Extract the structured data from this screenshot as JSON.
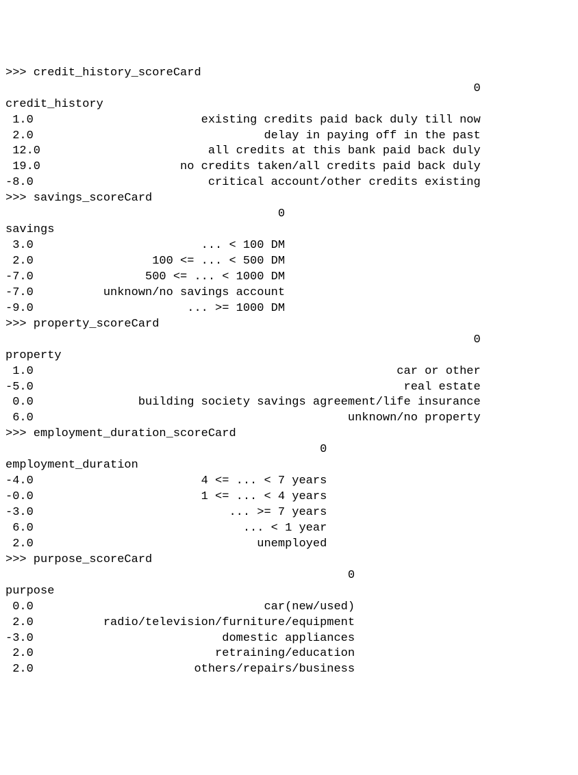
{
  "prompt": ">>>",
  "commands": {
    "credit_history": "credit_history_scoreCard",
    "savings": "savings_scoreCard",
    "property": "property_scoreCard",
    "employment": "employment_duration_scoreCard",
    "purpose": "purpose_scoreCard"
  },
  "col_header": "0",
  "credit_history": {
    "header": "credit_history",
    "rows": [
      {
        "score": " 1.0",
        "label": "existing credits paid back duly till now"
      },
      {
        "score": " 2.0",
        "label": "delay in paying off in the past"
      },
      {
        "score": " 12.0",
        "label": "all credits at this bank paid back duly"
      },
      {
        "score": " 19.0",
        "label": "no credits taken/all credits paid back duly"
      },
      {
        "score": "-8.0",
        "label": "critical account/other credits existing"
      }
    ]
  },
  "savings": {
    "header": "savings",
    "rows": [
      {
        "score": " 3.0",
        "label": "... < 100 DM"
      },
      {
        "score": " 2.0",
        "label": "100 <= ... < 500 DM"
      },
      {
        "score": "-7.0",
        "label": "500 <= ... < 1000 DM"
      },
      {
        "score": "-7.0",
        "label": "unknown/no savings account"
      },
      {
        "score": "-9.0",
        "label": "... >= 1000 DM"
      }
    ]
  },
  "property": {
    "header": "property",
    "rows": [
      {
        "score": " 1.0",
        "label": "car or other"
      },
      {
        "score": "-5.0",
        "label": "real estate"
      },
      {
        "score": " 0.0",
        "label": "building society savings agreement/life insurance"
      },
      {
        "score": " 6.0",
        "label": "unknown/no property"
      }
    ]
  },
  "employment": {
    "header": "employment_duration",
    "rows": [
      {
        "score": "-4.0",
        "label": "4 <= ... < 7 years"
      },
      {
        "score": "-0.0",
        "label": "1 <= ... < 4 years"
      },
      {
        "score": "-3.0",
        "label": "... >= 7 years"
      },
      {
        "score": " 6.0",
        "label": "... < 1 year"
      },
      {
        "score": " 2.0",
        "label": "unemployed"
      }
    ]
  },
  "purpose": {
    "header": "purpose",
    "rows": [
      {
        "score": " 0.0",
        "label": "car(new/used)"
      },
      {
        "score": " 2.0",
        "label": "radio/television/furniture/equipment"
      },
      {
        "score": "-3.0",
        "label": "domestic appliances"
      },
      {
        "score": " 2.0",
        "label": "retraining/education"
      },
      {
        "score": " 2.0",
        "label": "others/repairs/business"
      }
    ]
  },
  "widths": {
    "credit_history": 68,
    "savings": 40,
    "property": 68,
    "employment": 46,
    "purpose": 50
  },
  "watermark": ""
}
